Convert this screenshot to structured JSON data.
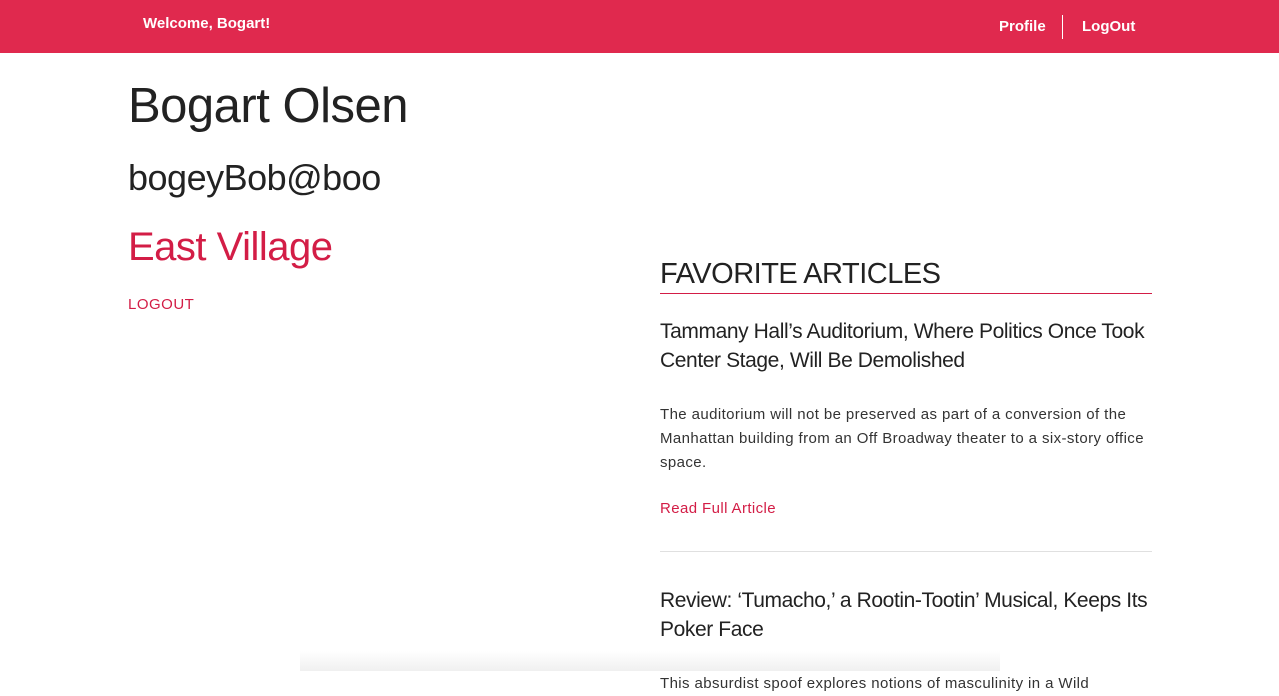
{
  "header": {
    "welcome": "Welcome, Bogart!",
    "nav": {
      "profile": "Profile",
      "logout": "LogOut"
    }
  },
  "user": {
    "name": "Bogart Olsen",
    "email": "bogeyBob@boo",
    "neighborhood": "East Village",
    "logout_label": "LOGOUT"
  },
  "favorites": {
    "heading": "FAVORITE ARTICLES",
    "articles": [
      {
        "title": "Tammany Hall’s Auditorium, Where Politics Once Took Center Stage, Will Be Demolished",
        "summary": "The auditorium will not be preserved as part of a conversion of the Manhattan building from an Off Broadway theater to a six-story office space.",
        "link_label": "Read Full Article"
      },
      {
        "title": "Review: ‘Tumacho,’ a Rootin-Tootin’ Musical, Keeps Its Poker Face",
        "summary": "This absurdist spoof explores notions of masculinity in a Wild"
      }
    ]
  },
  "colors": {
    "accent": "#e0294e",
    "link": "#d31d46"
  }
}
